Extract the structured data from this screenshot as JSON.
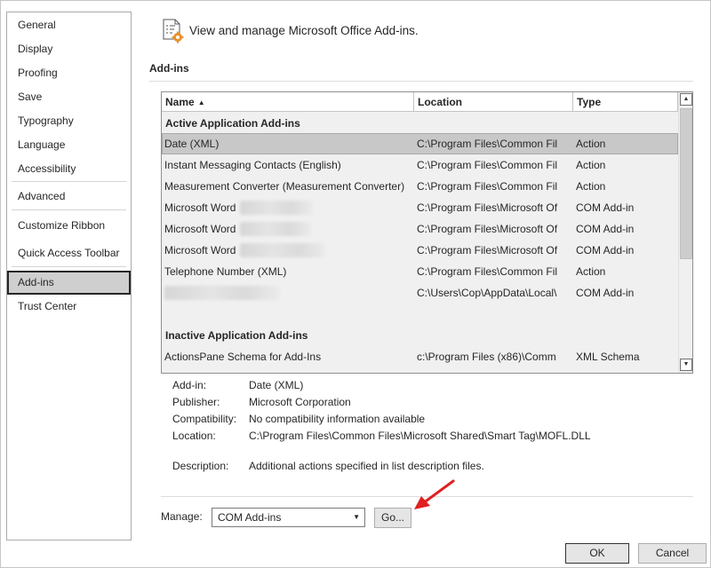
{
  "sidebar": {
    "items": [
      {
        "label": "General"
      },
      {
        "label": "Display"
      },
      {
        "label": "Proofing"
      },
      {
        "label": "Save"
      },
      {
        "label": "Typography"
      },
      {
        "label": "Language"
      },
      {
        "label": "Accessibility"
      },
      {
        "label": "Advanced"
      },
      {
        "label": "Customize Ribbon"
      },
      {
        "label": "Quick Access Toolbar"
      },
      {
        "label": "Add-ins",
        "selected": true
      },
      {
        "label": "Trust Center"
      }
    ]
  },
  "header": {
    "icon": "addins-settings-icon",
    "text": "View and manage Microsoft Office Add-ins."
  },
  "section_title": "Add-ins",
  "table": {
    "columns": [
      "Name",
      "Location",
      "Type"
    ],
    "sort_indicator": "▲",
    "active_group": "Active Application Add-ins",
    "rows": [
      {
        "name": "Date (XML)",
        "location": "C:\\Program Files\\Common Fil",
        "type": "Action",
        "selected": true
      },
      {
        "name": "Instant Messaging Contacts (English)",
        "location": "C:\\Program Files\\Common Fil",
        "type": "Action"
      },
      {
        "name": "Measurement Converter (Measurement Converter)",
        "location": "C:\\Program Files\\Common Fil",
        "type": "Action"
      },
      {
        "name": "Microsoft Word",
        "location": "C:\\Program Files\\Microsoft Of",
        "type": "COM Add-in",
        "blurred_suffix": true
      },
      {
        "name": "Microsoft Word",
        "location": "C:\\Program Files\\Microsoft Of",
        "type": "COM Add-in",
        "blurred_suffix": true
      },
      {
        "name": "Microsoft Word",
        "location": "C:\\Program Files\\Microsoft Of",
        "type": "COM Add-in",
        "blurred_suffix": true
      },
      {
        "name": "Telephone Number (XML)",
        "location": "C:\\Program Files\\Common Fil",
        "type": "Action"
      },
      {
        "name": "",
        "location": "C:\\Users\\Cop\\AppData\\Local\\",
        "type": "COM Add-in",
        "blurred_name": true
      }
    ],
    "inactive_group": "Inactive Application Add-ins",
    "inactive_rows": [
      {
        "name": "ActionsPane Schema for Add-Ins",
        "location": "c:\\Program Files (x86)\\Comm",
        "type": "XML Schema"
      }
    ]
  },
  "details": {
    "addin_label": "Add-in:",
    "addin_value": "Date (XML)",
    "publisher_label": "Publisher:",
    "publisher_value": "Microsoft Corporation",
    "compat_label": "Compatibility:",
    "compat_value": "No compatibility information available",
    "location_label": "Location:",
    "location_value": "C:\\Program Files\\Common Files\\Microsoft Shared\\Smart Tag\\MOFL.DLL",
    "description_label": "Description:",
    "description_value": "Additional actions specified in list description files."
  },
  "manage": {
    "label": "Manage:",
    "selected": "COM Add-ins",
    "go_label": "Go..."
  },
  "footer": {
    "ok_label": "OK",
    "cancel_label": "Cancel"
  },
  "colors": {
    "selection": "#c8c8c8",
    "annotation_arrow": "#e02020"
  }
}
